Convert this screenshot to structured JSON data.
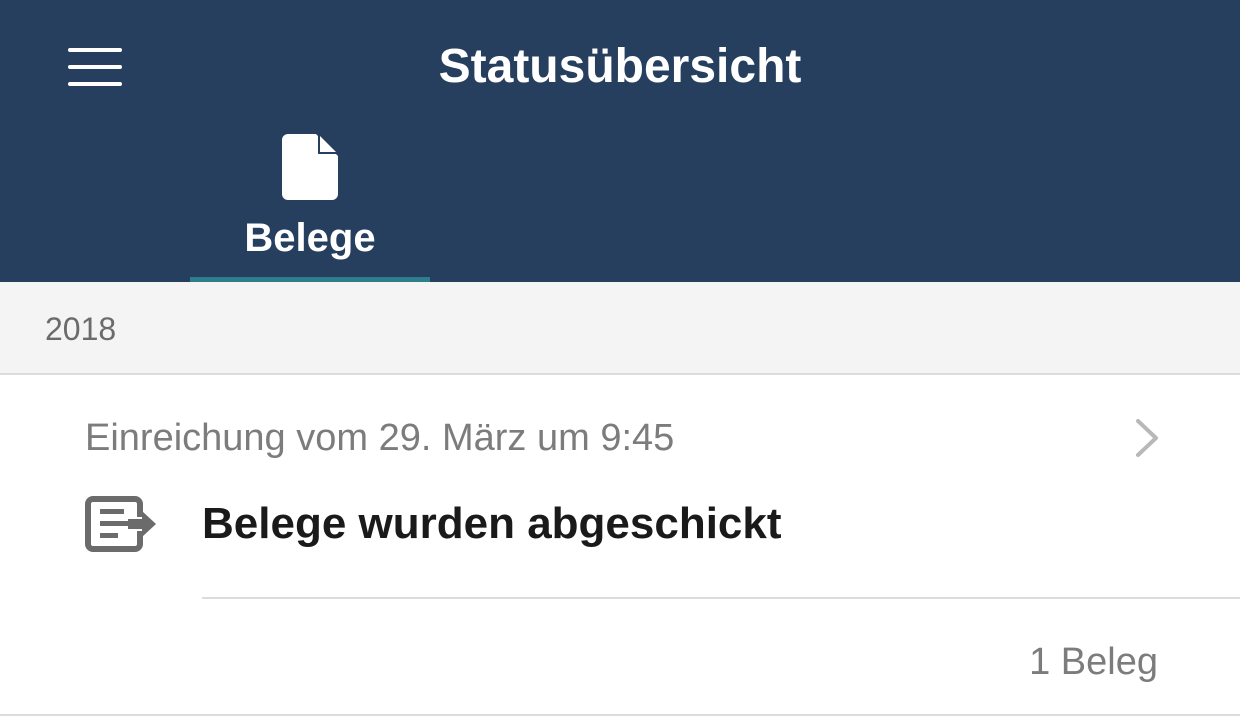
{
  "colors": {
    "header_bg": "#263f5f",
    "tab_indicator": "#2d7d8a",
    "section_bg": "#f4f4f4",
    "secondary_text": "#7c7c7c",
    "primary_text": "#1a1a1a"
  },
  "header": {
    "menu_icon": "hamburger-menu-icon",
    "title": "Statusübersicht",
    "tabs": [
      {
        "icon": "document-icon",
        "label": "Belege",
        "selected": true
      }
    ]
  },
  "sections": [
    {
      "year": "2018",
      "entries": [
        {
          "date": "Einreichung vom 29. März um 9:45",
          "status_icon": "document-send-icon",
          "status": "Belege wurden abgeschickt",
          "count": "1 Beleg",
          "chevron_icon": "chevron-right-icon"
        }
      ]
    }
  ]
}
